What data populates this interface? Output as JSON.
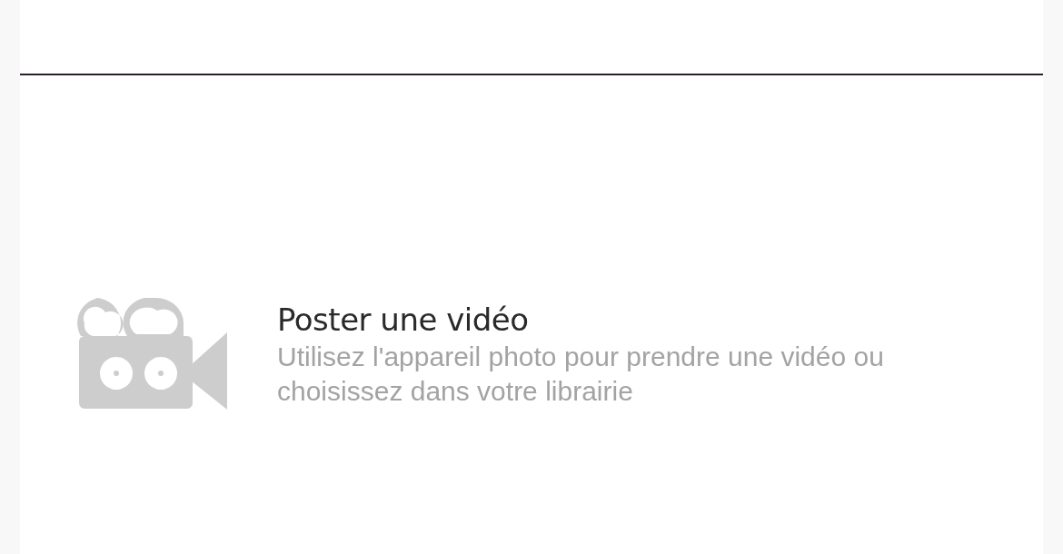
{
  "option": {
    "title": "Poster une vidéo",
    "description": "Utilisez l'appareil photo pour prendre une vidéo ou choisissez dans votre librairie"
  }
}
